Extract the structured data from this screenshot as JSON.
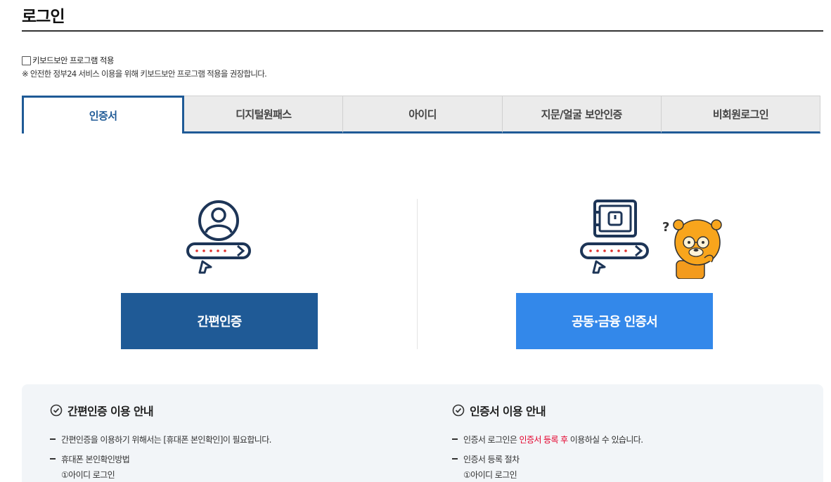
{
  "page": {
    "title": "로그인"
  },
  "keyboard_security": {
    "checkbox_label": "키보드보안 프로그램 적용",
    "checked": false,
    "note": "※ 안전한 정부24 서비스 이용을 위해 키보드보안 프로그램 적용을 권장합니다."
  },
  "tabs": [
    {
      "label": "인증서",
      "active": true
    },
    {
      "label": "디지털원패스",
      "active": false
    },
    {
      "label": "아이디",
      "active": false
    },
    {
      "label": "지문/얼굴 보안인증",
      "active": false
    },
    {
      "label": "비회원로그인",
      "active": false
    }
  ],
  "login_options": {
    "simple_auth_button": "간편인증",
    "cert_button": "공동·금융 인증서",
    "icons": [
      "user-password-icon",
      "safe-password-icon",
      "character-question-icon"
    ]
  },
  "guide": {
    "simple": {
      "title": "간편인증 이용 안내",
      "items": [
        "간편인증을 이용하기 위해서는 [휴대폰 본인확인]이 필요합니다.",
        "휴대폰 본인확인방법"
      ],
      "sub": "①아이디 로그인"
    },
    "cert": {
      "title": "인증서 이용 안내",
      "item1_before": "인증서 로그인은 ",
      "item1_highlight": "인증서 등록 후",
      "item1_after": " 이용하실 수 있습니다.",
      "item2": "인증서 등록 절차",
      "sub": "①아이디 로그인"
    }
  },
  "colors": {
    "primary": "#1f5a96",
    "accent": "#3388ea",
    "highlight": "#e4002b",
    "guide_bg": "#f2f5f8"
  }
}
